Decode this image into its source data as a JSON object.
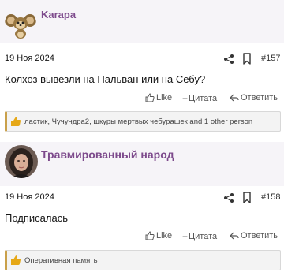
{
  "posts": [
    {
      "author": "Karapa",
      "avatar": "cheburashka-avatar",
      "date": "19 Ноя 2024",
      "number": "#157",
      "message": "Колхоз вывезли на Пальван или на Себу?",
      "actions": {
        "like": "Like",
        "quote": "Цитата",
        "reply": "Ответить"
      },
      "reactions": "ластик, Чучундра2, шкуры мертвых чебурашек and 1 other person"
    },
    {
      "author": "Травмированный народ",
      "avatar": "woman-portrait-avatar",
      "date": "19 Ноя 2024",
      "number": "#158",
      "message": "Подписалась",
      "actions": {
        "like": "Like",
        "quote": "Цитата",
        "reply": "Ответить"
      },
      "reactions": "Оперативная память"
    }
  ],
  "colors": {
    "author_name": "#7d4a8c",
    "author_bg": "#f6f4f8",
    "reaction_accent": "#c9a04a",
    "thumb": "#e6a817"
  }
}
